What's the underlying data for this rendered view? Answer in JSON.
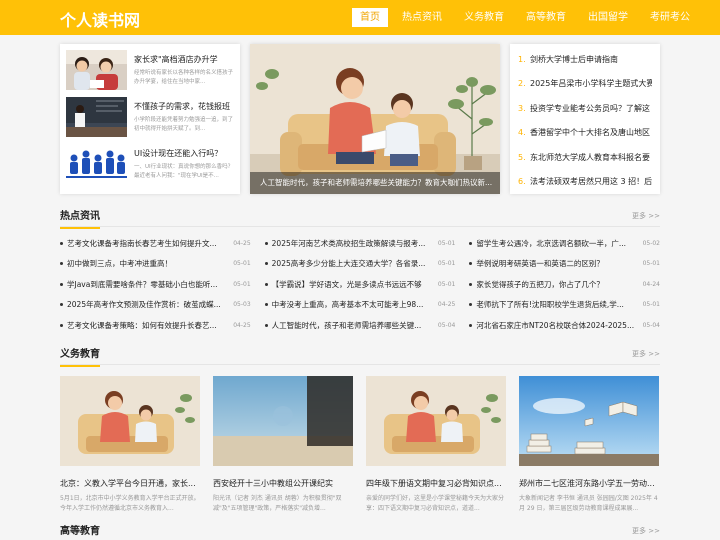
{
  "header": {
    "logo": "个人读书网",
    "nav": [
      "首页",
      "热点资讯",
      "义务教育",
      "高等教育",
      "出国留学",
      "考研考公"
    ]
  },
  "featured": [
    {
      "title": "家长求\"高档酒店办升学",
      "desc": "经常听说有家长以各种各样的名义搭孩子办升学宴，给住在当地中家..."
    },
    {
      "title": "不懂孩子的需求，花钱报班",
      "desc": "小学阶段还能凭着努力勉强追一追，到了初中就得开始拼天赋了。到..."
    },
    {
      "title": "UI设计现在还能入行吗？",
      "desc": "一、UI行业现状：真说你想的那么香吗？最近老有人问我：\"现在学UI是不..."
    }
  ],
  "banner": {
    "caption": "人工智能时代，孩子和老师需培养哪些关键能力？教育大咖们热议新..."
  },
  "ranking": [
    {
      "num": "1.",
      "title": "剑桥大学博士后申请指南"
    },
    {
      "num": "2.",
      "title": "2025年吕梁市小学科学主题式大赛"
    },
    {
      "num": "3.",
      "title": "投资学专业能考公务员吗？了解这"
    },
    {
      "num": "4.",
      "title": "香港留学中个十大排名及唐山地区"
    },
    {
      "num": "5.",
      "title": "东北师范大学成人教育本科报名要"
    },
    {
      "num": "6.",
      "title": "法考法硕双考居然只用这 3 招！后"
    }
  ],
  "hot": {
    "title": "热点资讯",
    "more": "更多 >>",
    "items": [
      {
        "title": "艺考文化课备考指南长春艺考生如何提升文...",
        "date": "04-25"
      },
      {
        "title": "2025年河南艺术类高校招生政策解读与报考...",
        "date": "05-01"
      },
      {
        "title": "留学生考公遇冷，北京选调名额砍一半，广...",
        "date": "05-02"
      },
      {
        "title": "初中做到三点，中考冲进重高！",
        "date": "05-01"
      },
      {
        "title": "2025高考多少分能上大连交通大学？各省录...",
        "date": "05-01"
      },
      {
        "title": "举例说明考研英语一和英语二的区别？",
        "date": "05-01"
      },
      {
        "title": "学Java到底需要啥条件？零基础小白也能听...",
        "date": "05-01"
      },
      {
        "title": "【学霸说】学好语文，光是多读点书远远不够",
        "date": "05-01"
      },
      {
        "title": "家长觉得孩子的五把刀，你占了几个？",
        "date": "04-24"
      },
      {
        "title": "2025年高考作文预测及佳作赏析：破茧成蝶...",
        "date": "05-03"
      },
      {
        "title": "中考没考上重高，高考基本不太可能考上98...",
        "date": "04-25"
      },
      {
        "title": "老师抗下了所有!沈阳职校学生退货后续,学...",
        "date": "05-01"
      },
      {
        "title": "艺考文化课备考策略：如何有效提升长春艺...",
        "date": "04-25"
      },
      {
        "title": "人工智能时代，孩子和老师需培养哪些关键...",
        "date": "05-04"
      },
      {
        "title": "河北省石家庄市NT20名校联合体2024-2025...",
        "date": "05-04"
      }
    ]
  },
  "compulsory": {
    "title": "义务教育",
    "more": "更多 >>",
    "cards": [
      {
        "title": "北京：义教入学平台今日开通，家长...",
        "desc": "5月1日，北京市中小学义务教育入学平台正式开放。今年入学工作仍然遵循北京市义务教育入..."
      },
      {
        "title": "西安经开十三小中教组公开课纪实",
        "desc": "阳光讯（记者 刘杰 通讯员 胡蓉）为积极贯彻\"双减\"及\"五项管理\"政策，严格落实\"减负增..."
      },
      {
        "title": "四年级下册语文期中复习必背知识点...",
        "desc": "亲爱的同学们好，这里是小学课堂秘籍今天为大家分享：四下语文期中复习必背知识点，道道..."
      },
      {
        "title": "郑州市二七区淮河东路小学五一劳动...",
        "desc": "大象新闻记者 李书恒 通讯员 张园园/文图 2025年 4 月 29 日，第三届区级劳动教育课程成果展..."
      }
    ]
  },
  "higher": {
    "title": "高等教育",
    "more": "更多 >>"
  }
}
